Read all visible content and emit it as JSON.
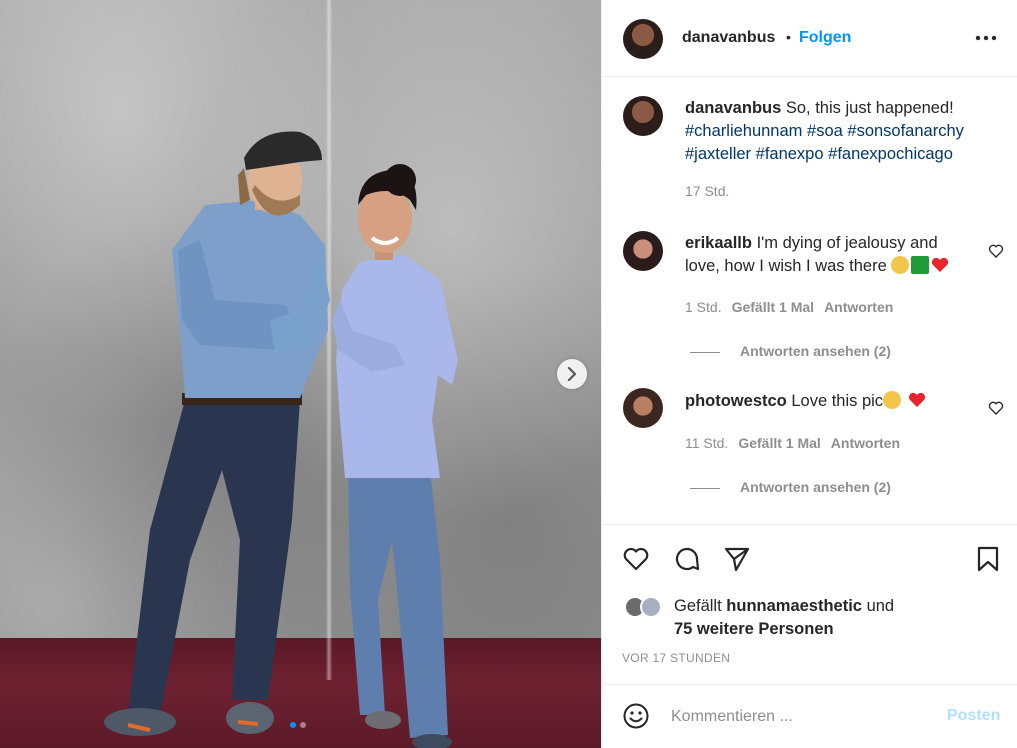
{
  "header": {
    "username": "danavanbus",
    "separator": "•",
    "follow_label": "Folgen"
  },
  "caption": {
    "username": "danavanbus",
    "text": "So, this just happened!",
    "hashtags": [
      "#charliehunnam",
      "#soa",
      "#sonsofanarchy",
      "#jaxteller",
      "#fanexpo",
      "#fanexpochicago"
    ],
    "time": "17 Std."
  },
  "comments": [
    {
      "username": "erikaallb",
      "text": "I'm dying of jealousy and love, how I wish I was there",
      "time": "1 Std.",
      "likes": "Gefällt 1 Mal",
      "reply_label": "Antworten",
      "view_replies": "Antworten ansehen (2)"
    },
    {
      "username": "photowestco",
      "text": "Love this pic",
      "time": "11 Std.",
      "likes": "Gefällt 1 Mal",
      "reply_label": "Antworten",
      "view_replies": "Antworten ansehen (2)"
    }
  ],
  "likes": {
    "prefix": "Gefällt",
    "user": "hunnamaesthetic",
    "middle": "und",
    "others": "75 weitere Personen"
  },
  "timestamp": "VOR 17 STUNDEN",
  "add_comment": {
    "placeholder": "Kommentieren ...",
    "post_label": "Posten"
  },
  "carousel": {
    "slide_count": 2,
    "current_slide": 1
  },
  "colors": {
    "link_blue": "#0095f6",
    "hashtag": "#00376b",
    "muted": "#8e8e8e"
  },
  "icons": [
    "more-icon",
    "next-arrow-icon",
    "heart-icon",
    "comment-icon",
    "share-icon",
    "bookmark-icon",
    "smiley-icon"
  ]
}
